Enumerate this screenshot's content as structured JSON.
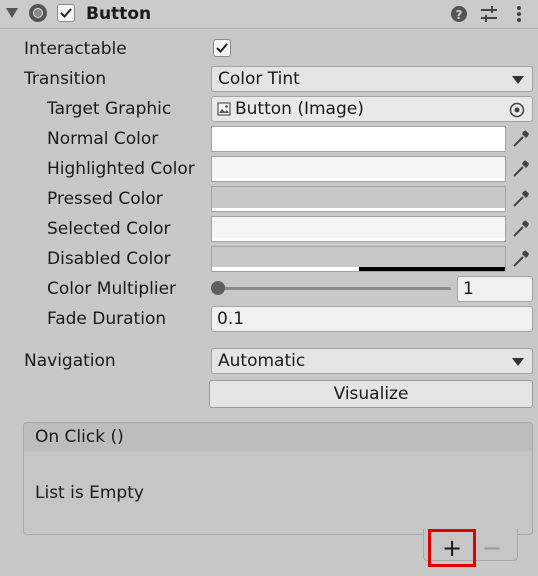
{
  "header": {
    "title": "Button",
    "enabled": true,
    "icons": [
      "foldout-arrow-icon",
      "component-icon",
      "help-icon",
      "presets-icon",
      "more-options-icon"
    ]
  },
  "properties": {
    "interactable": {
      "label": "Interactable",
      "checked": true
    },
    "transition": {
      "label": "Transition",
      "value": "Color Tint"
    },
    "target_graphic": {
      "label": "Target Graphic",
      "value": "Button (Image)"
    },
    "normal_color": {
      "label": "Normal Color",
      "color": "#ffffff",
      "alpha": 1.0
    },
    "highlighted_color": {
      "label": "Highlighted Color",
      "color": "#f5f5f5",
      "alpha": 1.0
    },
    "pressed_color": {
      "label": "Pressed Color",
      "color": "#c8c8c8",
      "alpha": 1.0
    },
    "selected_color": {
      "label": "Selected Color",
      "color": "#f5f5f5",
      "alpha": 1.0
    },
    "disabled_color": {
      "label": "Disabled Color",
      "color": "#c8c8c8",
      "alpha": 0.5
    },
    "color_multiplier": {
      "label": "Color Multiplier",
      "value": "1",
      "slider_fraction": 0.0
    },
    "fade_duration": {
      "label": "Fade Duration",
      "value": "0.1"
    },
    "navigation": {
      "label": "Navigation",
      "value": "Automatic"
    },
    "visualize": {
      "label": "Visualize"
    }
  },
  "on_click": {
    "header": "On Click ()",
    "empty_text": "List is Empty",
    "add_label": "+",
    "remove_label": "−"
  },
  "colors": {
    "highlight_box": "#e20000"
  }
}
